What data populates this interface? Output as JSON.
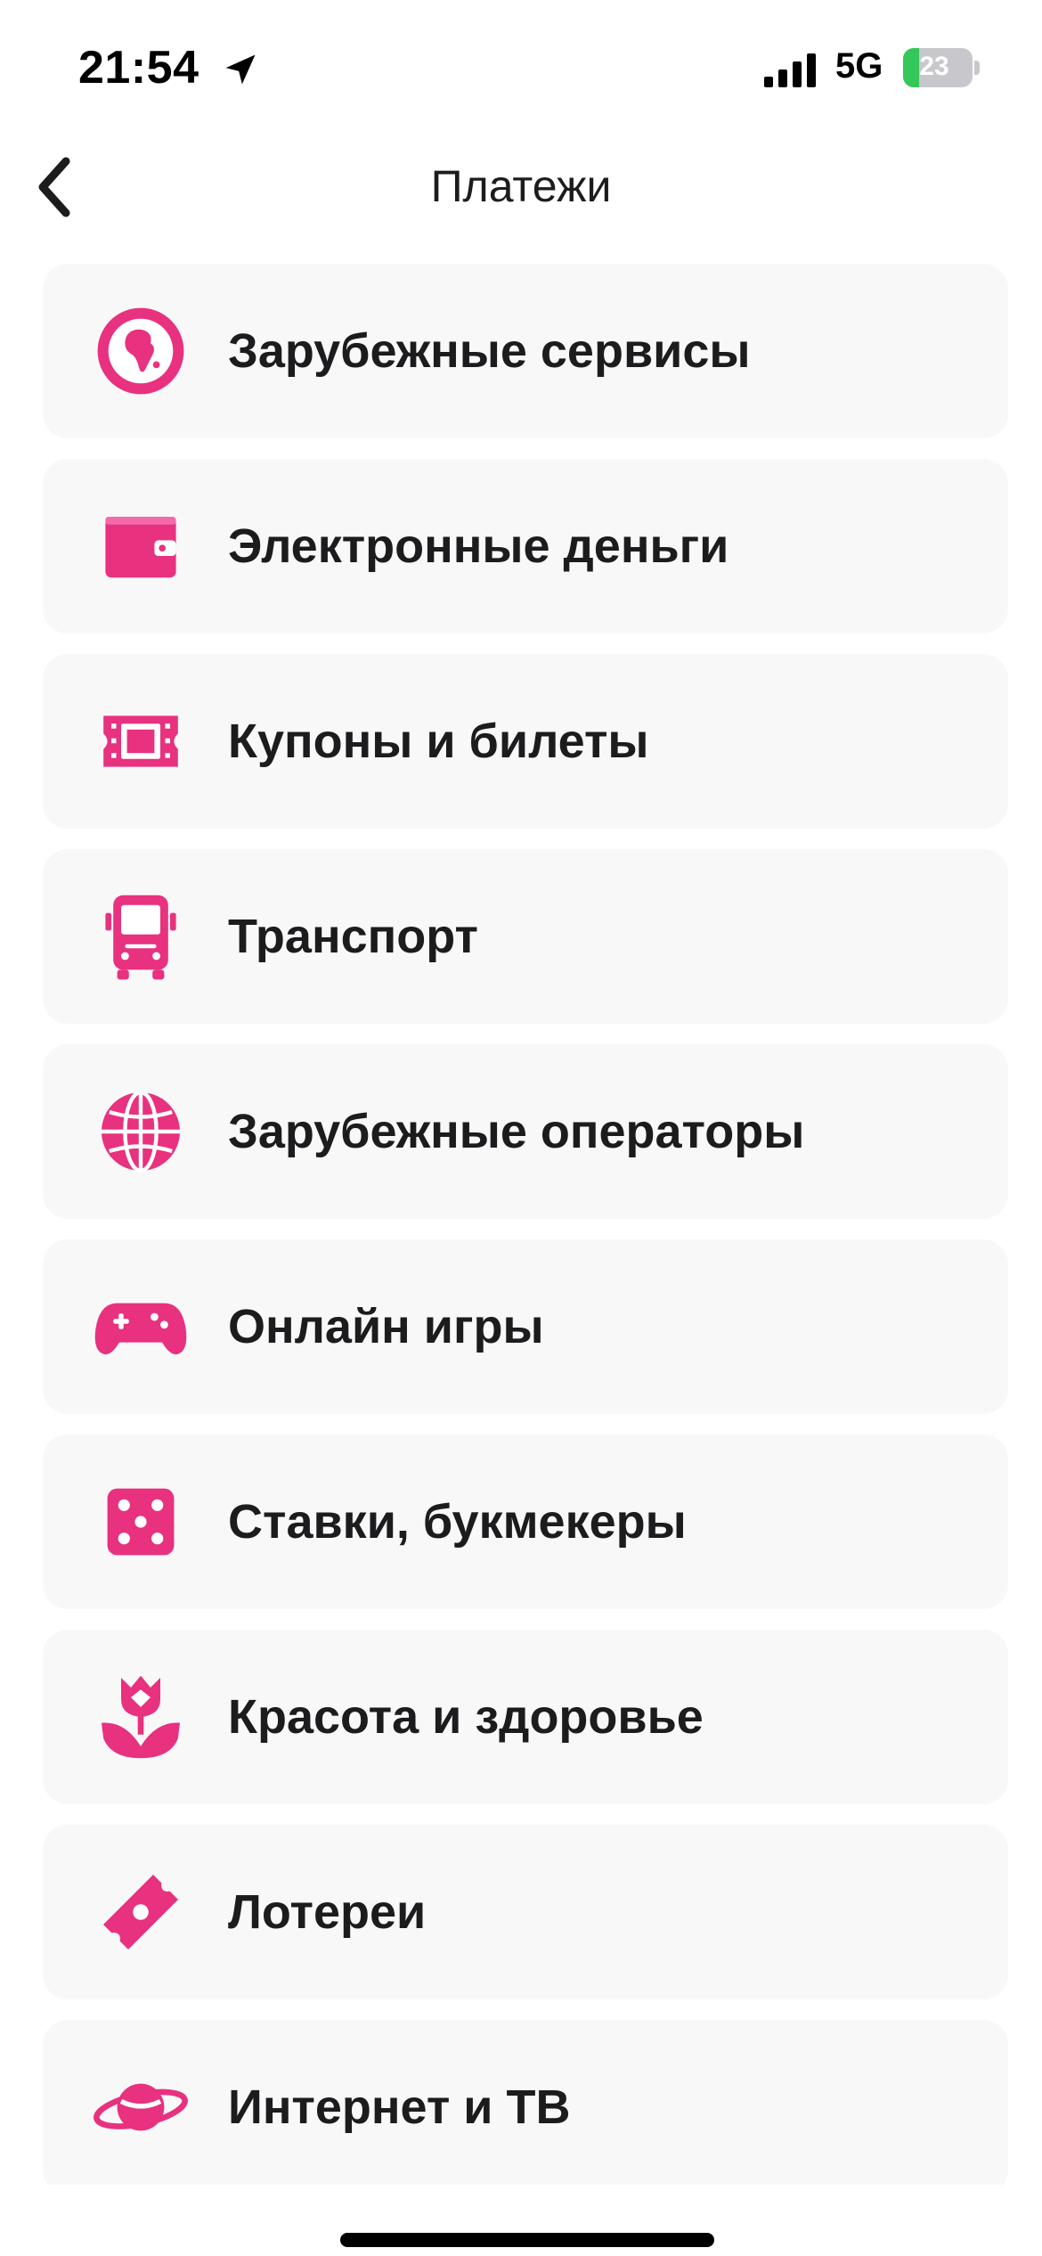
{
  "status_bar": {
    "time": "21:54",
    "network": "5G",
    "battery_level": "23",
    "battery_fraction": 0.23
  },
  "header": {
    "title": "Платежи",
    "back_icon": "chevron-left-icon"
  },
  "colors": {
    "accent": "#e8317f",
    "card_bg": "#f8f8f8",
    "text": "#1c1c1e",
    "battery_green": "#34c759"
  },
  "items": [
    {
      "label": "Зарубежные сервисы",
      "icon": "globe-africa-icon"
    },
    {
      "label": "Электронные деньги",
      "icon": "wallet-icon"
    },
    {
      "label": "Купоны и билеты",
      "icon": "film-ticket-icon"
    },
    {
      "label": "Транспорт",
      "icon": "bus-icon"
    },
    {
      "label": "Зарубежные операторы",
      "icon": "globe-grid-icon"
    },
    {
      "label": "Онлайн игры",
      "icon": "gamepad-icon"
    },
    {
      "label": "Ставки, букмекеры",
      "icon": "dice-icon"
    },
    {
      "label": "Красота и здоровье",
      "icon": "tulip-icon"
    },
    {
      "label": "Лотереи",
      "icon": "lottery-ticket-icon"
    },
    {
      "label": "Интернет и ТВ",
      "icon": "planet-icon"
    }
  ]
}
